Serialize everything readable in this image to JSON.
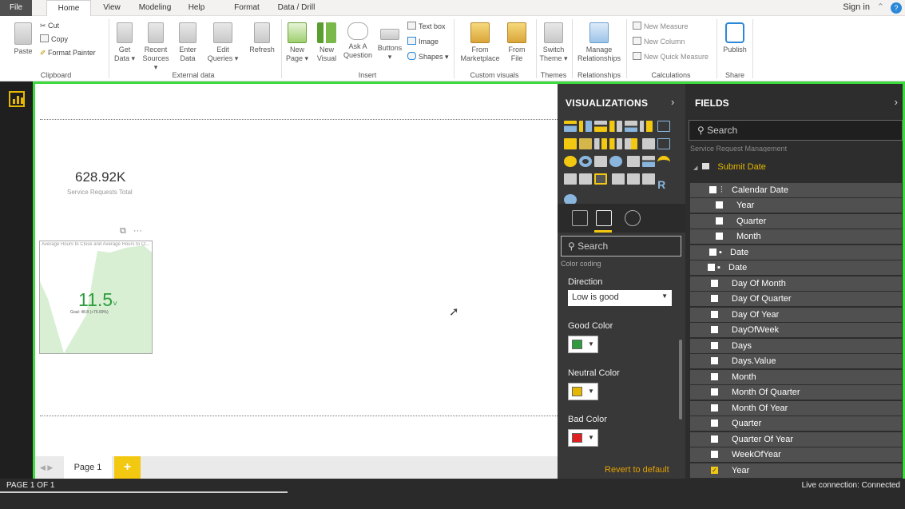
{
  "tabs": {
    "file": "File",
    "home": "Home",
    "view": "View",
    "modeling": "Modeling",
    "help": "Help",
    "format": "Format",
    "data_drill": "Data / Drill",
    "sign_in": "Sign in"
  },
  "ribbon": {
    "paste": "Paste",
    "cut": "Cut",
    "copy": "Copy",
    "format_painter": "Format Painter",
    "get_data": [
      "Get",
      "Data ▾"
    ],
    "recent_sources": [
      "Recent",
      "Sources ▾"
    ],
    "enter_data": [
      "Enter",
      "Data"
    ],
    "edit_queries": [
      "Edit",
      "Queries ▾"
    ],
    "refresh": "Refresh",
    "new_page": [
      "New",
      "Page ▾"
    ],
    "new_visual": [
      "New",
      "Visual"
    ],
    "ask_question": [
      "Ask A",
      "Question"
    ],
    "buttons": [
      "Buttons",
      "▾"
    ],
    "text_box": "Text box",
    "image": "Image",
    "shapes": "Shapes ▾",
    "from_marketplace": [
      "From",
      "Marketplace"
    ],
    "from_file": [
      "From",
      "File"
    ],
    "switch_theme": [
      "Switch",
      "Theme ▾"
    ],
    "manage_relationships": [
      "Manage",
      "Relationships"
    ],
    "new_measure": "New Measure",
    "new_column": "New Column",
    "new_quick_measure": "New Quick Measure",
    "publish": "Publish",
    "groups": {
      "clipboard": "Clipboard",
      "external_data": "External data",
      "insert": "Insert",
      "custom_visuals": "Custom visuals",
      "themes": "Themes",
      "relationships": "Relationships",
      "calculations": "Calculations",
      "share": "Share"
    }
  },
  "canvas": {
    "kpi_value": "628.92K",
    "kpi_label": "Service Requests Total",
    "visual_title": "Average Hours to Close and Average Hours to Cl...",
    "visual_value": "11.5",
    "visual_goal": "Goal: 48.8 (+76.69%)",
    "page_tab": "Page 1",
    "add_page": "+"
  },
  "visualizations": {
    "title": "VISUALIZATIONS",
    "search_placeholder": "Search",
    "cut_text": "Color coding",
    "direction_label": "Direction",
    "direction_value": "Low is good",
    "good_color_label": "Good Color",
    "neutral_color_label": "Neutral Color",
    "bad_color_label": "Bad Color",
    "revert": "Revert to default",
    "colors": {
      "good": "#2e9c3e",
      "neutral": "#e5b700",
      "bad": "#e02020"
    }
  },
  "fields": {
    "title": "FIELDS",
    "search_placeholder": "Search",
    "cut_text": "Service Request Management",
    "table": "Submit Date",
    "items": [
      {
        "label": "Calendar Date",
        "indent": 1,
        "checked": false
      },
      {
        "label": "Year",
        "indent": 2,
        "checked": false
      },
      {
        "label": "Quarter",
        "indent": 2,
        "checked": false
      },
      {
        "label": "Month",
        "indent": 2,
        "checked": false
      },
      {
        "label": "Date",
        "indent": 1,
        "checked": false
      },
      {
        "label": "Date",
        "indent": 0,
        "checked": false
      },
      {
        "label": "Day Of Month",
        "indent": 0,
        "checked": false
      },
      {
        "label": "Day Of Quarter",
        "indent": 0,
        "checked": false
      },
      {
        "label": "Day Of Year",
        "indent": 0,
        "checked": false
      },
      {
        "label": "DayOfWeek",
        "indent": 0,
        "checked": false
      },
      {
        "label": "Days",
        "indent": 0,
        "checked": false
      },
      {
        "label": "Days.Value",
        "indent": 0,
        "checked": false
      },
      {
        "label": "Month",
        "indent": 0,
        "checked": false
      },
      {
        "label": "Month Of Quarter",
        "indent": 0,
        "checked": false
      },
      {
        "label": "Month Of Year",
        "indent": 0,
        "checked": false
      },
      {
        "label": "Quarter",
        "indent": 0,
        "checked": false
      },
      {
        "label": "Quarter Of Year",
        "indent": 0,
        "checked": false
      },
      {
        "label": "WeekOfYear",
        "indent": 0,
        "checked": false
      },
      {
        "label": "Year",
        "indent": 0,
        "checked": true
      }
    ]
  },
  "status": {
    "page": "PAGE 1 OF 1",
    "connection": "Live connection: Connected"
  }
}
